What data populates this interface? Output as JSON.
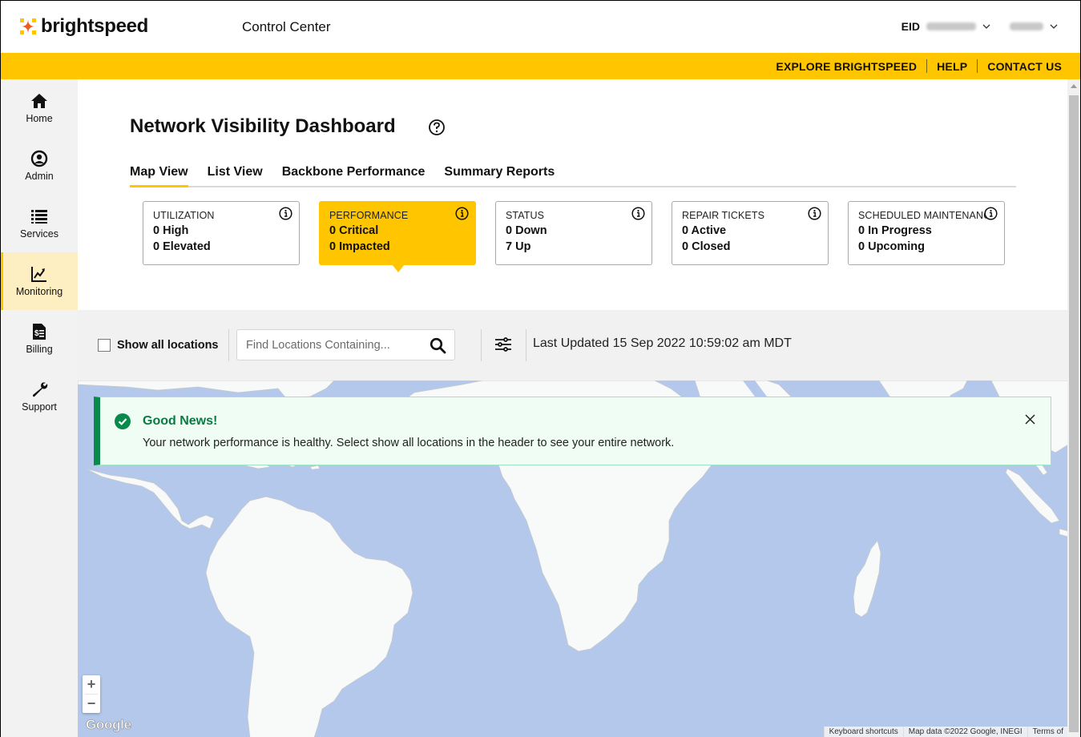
{
  "header": {
    "brand": "brightspeed",
    "app_title": "Control Center",
    "eid_label": "EID",
    "eid_value_redacted": true,
    "user_redacted": true
  },
  "utility_nav": {
    "links": [
      "EXPLORE BRIGHTSPEED",
      "HELP",
      "CONTACT US"
    ]
  },
  "sidebar": {
    "items": [
      {
        "label": "Home",
        "icon": "home-icon",
        "active": false
      },
      {
        "label": "Admin",
        "icon": "user-circle-icon",
        "active": false
      },
      {
        "label": "Services",
        "icon": "list-icon",
        "active": false
      },
      {
        "label": "Monitoring",
        "icon": "chart-line-icon",
        "active": true
      },
      {
        "label": "Billing",
        "icon": "invoice-icon",
        "active": false
      },
      {
        "label": "Support",
        "icon": "wrench-icon",
        "active": false
      }
    ]
  },
  "page": {
    "title": "Network Visibility Dashboard",
    "tabs": [
      {
        "label": "Map View",
        "active": true
      },
      {
        "label": "List View",
        "active": false
      },
      {
        "label": "Backbone Performance",
        "active": false
      },
      {
        "label": "Summary Reports",
        "active": false
      }
    ],
    "cards": [
      {
        "title": "UTILIZATION",
        "lines": [
          "0 High",
          "0 Elevated"
        ],
        "active": false
      },
      {
        "title": "PERFORMANCE",
        "lines": [
          "0 Critical",
          "0 Impacted"
        ],
        "active": true
      },
      {
        "title": "STATUS",
        "lines": [
          "0 Down",
          "7 Up"
        ],
        "active": false
      },
      {
        "title": "REPAIR TICKETS",
        "lines": [
          "0 Active",
          "0 Closed"
        ],
        "active": false
      },
      {
        "title": "SCHEDULED MAINTENANCE",
        "lines": [
          "0 In Progress",
          "0 Upcoming"
        ],
        "active": false
      }
    ]
  },
  "toolbar": {
    "show_all_label": "Show all locations",
    "show_all_checked": false,
    "search_placeholder": "Find Locations Containing...",
    "search_value": "",
    "last_updated": "Last Updated 15 Sep 2022 10:59:02 am MDT"
  },
  "alert": {
    "title": "Good News!",
    "message": "Your network performance is healthy. Select show all locations in the header to see your entire network."
  },
  "map": {
    "zoom_in": "+",
    "zoom_out": "−",
    "provider": "Google",
    "attribution": [
      "Keyboard shortcuts",
      "Map data ©2022 Google, INEGI",
      "Terms of"
    ]
  },
  "colors": {
    "brand_yellow": "#ffc600",
    "success_green": "#0a8a4a",
    "water": "#b3c8ea",
    "land": "#f8f9f9"
  }
}
